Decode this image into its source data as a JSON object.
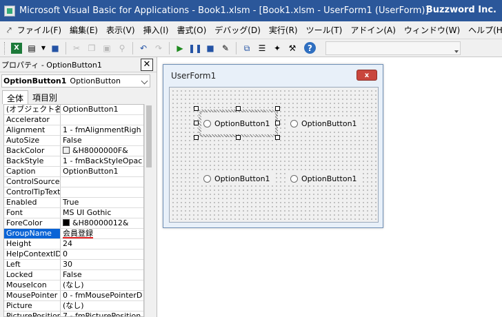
{
  "window": {
    "title": "Microsoft Visual Basic for Applications - Book1.xlsm - [Book1.xlsm - UserForm1 (UserForm)]",
    "brand": "Buzzword Inc."
  },
  "menu": {
    "icon": "vba-ide-icon",
    "items": [
      "ファイル(F)",
      "編集(E)",
      "表示(V)",
      "挿入(I)",
      "書式(O)",
      "デバッグ(D)",
      "実行(R)",
      "ツール(T)",
      "アドイン(A)",
      "ウィンドウ(W)",
      "ヘルプ(H)"
    ]
  },
  "toolbar": {
    "excel_label": "X",
    "help_label": "?"
  },
  "properties": {
    "title": "プロパティ - OptionButton1",
    "object_name": "OptionButton1",
    "object_type": "OptionButton",
    "tabs": [
      "全体",
      "項目別"
    ],
    "active_tab": "全体",
    "rows": [
      {
        "name": "(オブジェクト名)",
        "value": "OptionButton1"
      },
      {
        "name": "Accelerator",
        "value": ""
      },
      {
        "name": "Alignment",
        "value": "1 - fmAlignmentRigh"
      },
      {
        "name": "AutoSize",
        "value": "False"
      },
      {
        "name": "BackColor",
        "value": "&H8000000F&",
        "swatch": "#f0f0f0"
      },
      {
        "name": "BackStyle",
        "value": "1 - fmBackStyleOpac"
      },
      {
        "name": "Caption",
        "value": "OptionButton1"
      },
      {
        "name": "ControlSource",
        "value": ""
      },
      {
        "name": "ControlTipText",
        "value": ""
      },
      {
        "name": "Enabled",
        "value": "True"
      },
      {
        "name": "Font",
        "value": "MS UI Gothic"
      },
      {
        "name": "ForeColor",
        "value": "&H80000012&",
        "swatch": "#000000"
      },
      {
        "name": "GroupName",
        "value": "会員登録",
        "selected": true
      },
      {
        "name": "Height",
        "value": "24"
      },
      {
        "name": "HelpContextID",
        "value": "0"
      },
      {
        "name": "Left",
        "value": "30"
      },
      {
        "name": "Locked",
        "value": "False"
      },
      {
        "name": "MouseIcon",
        "value": "(なし)"
      },
      {
        "name": "MousePointer",
        "value": "0 - fmMousePointerD"
      },
      {
        "name": "Picture",
        "value": "(なし)"
      },
      {
        "name": "PicturePosition",
        "value": "7 - fmPicturePosition"
      }
    ]
  },
  "userform": {
    "title": "UserForm1",
    "close_label": "x",
    "options": [
      {
        "caption": "OptionButton1",
        "selected": true
      },
      {
        "caption": "OptionButton1"
      },
      {
        "caption": "OptionButton1"
      },
      {
        "caption": "OptionButton1"
      }
    ]
  },
  "colors": {
    "titlebar": "#2b579a",
    "selection": "#0a64d6",
    "underline": "#e22020"
  }
}
